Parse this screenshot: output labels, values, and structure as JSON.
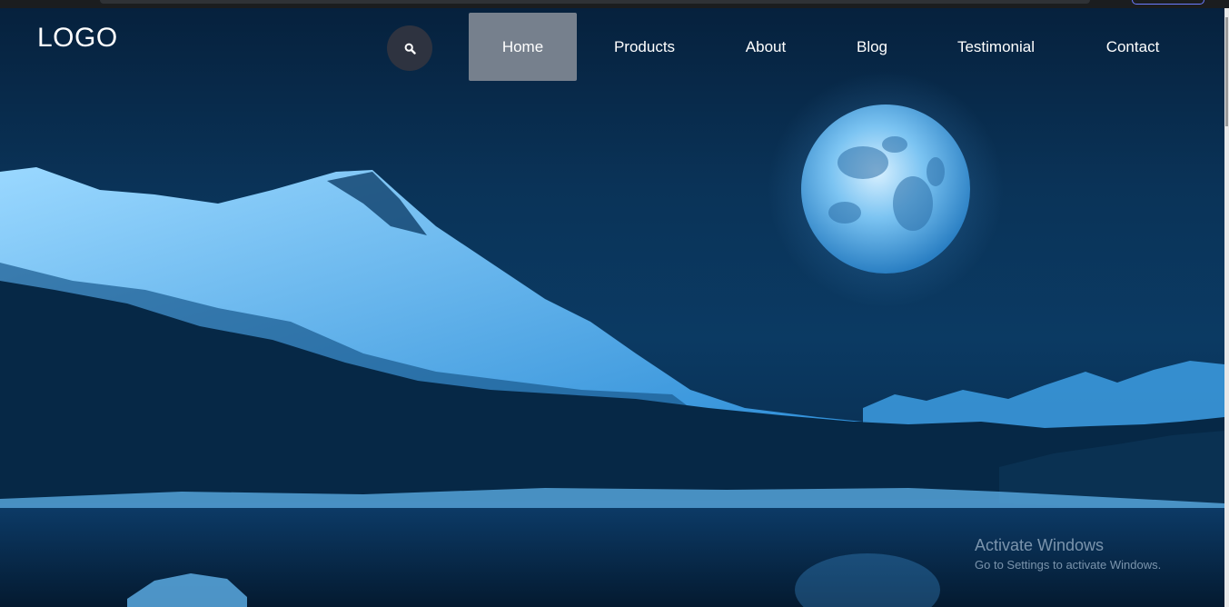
{
  "header": {
    "logo": "LOGO"
  },
  "search": {
    "icon": "search-icon"
  },
  "nav": {
    "items": [
      {
        "label": "Home",
        "active": true
      },
      {
        "label": "Products",
        "active": false
      },
      {
        "label": "About",
        "active": false
      },
      {
        "label": "Blog",
        "active": false
      },
      {
        "label": "Testimonial",
        "active": false
      },
      {
        "label": "Contact",
        "active": false
      }
    ]
  },
  "hero": {
    "image": "night-mountain-lake-moon"
  },
  "watermark": {
    "title": "Activate Windows",
    "subtitle": "Go to Settings to activate Windows."
  },
  "colors": {
    "active_nav_bg": "#76808d",
    "search_bg": "#2e3340",
    "sky": "#0a3358",
    "snow": "#4fb0f0"
  }
}
